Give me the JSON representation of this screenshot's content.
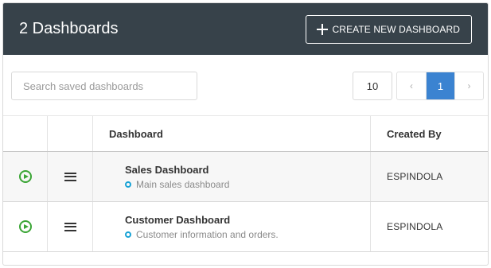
{
  "header": {
    "title": "2 Dashboards",
    "create_button_label": "CREATE NEW DASHBOARD"
  },
  "toolbar": {
    "search_placeholder": "Search saved dashboards",
    "search_value": "",
    "page_size": "10",
    "pager": {
      "prev": "‹",
      "current": "1",
      "next": "›"
    }
  },
  "table": {
    "columns": [
      "",
      "",
      "Dashboard",
      "Created By"
    ],
    "rows": [
      {
        "title": "Sales Dashboard",
        "description": "Main sales dashboard",
        "created_by": "ESPINDOLA"
      },
      {
        "title": "Customer Dashboard",
        "description": "Customer information and orders.",
        "created_by": "ESPINDOLA"
      }
    ]
  },
  "icons": {
    "create": "plus-icon",
    "run": "play-icon",
    "menu": "hamburger-menu-icon",
    "description_marker": "circle-dot-icon"
  },
  "colors": {
    "header_bg": "#37424a",
    "accent": "#3b83d1",
    "run_icon": "#3aa535",
    "description_dot": "#1aa3d6"
  }
}
